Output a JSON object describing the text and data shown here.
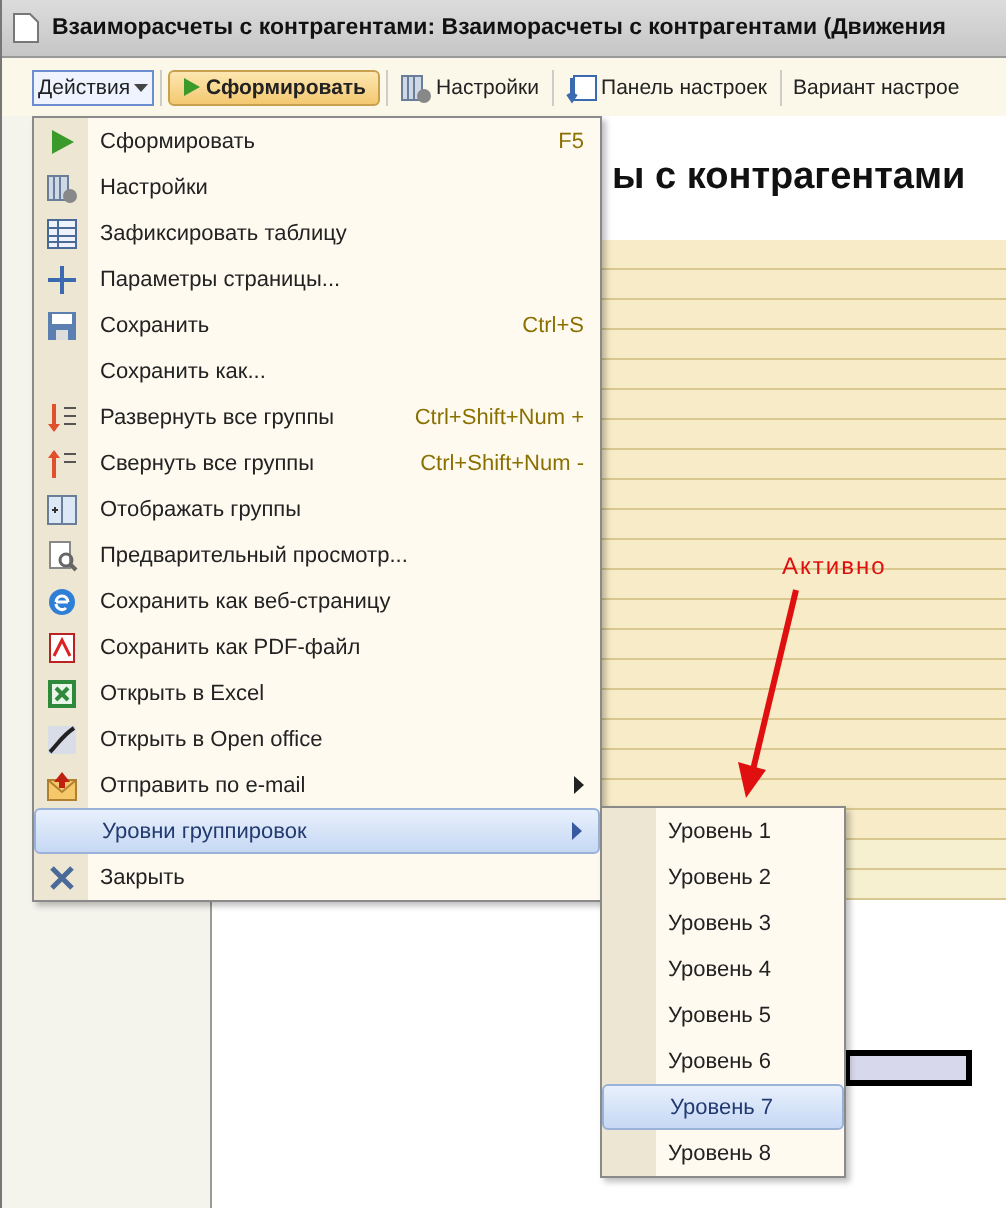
{
  "window": {
    "title": "Взаиморасчеты с контрагентами: Взаиморасчеты с контрагентами (Движения"
  },
  "toolbar": [
    {
      "kind": "menu",
      "label": "Действия",
      "open": true
    },
    {
      "kind": "primary",
      "label": "Сформировать"
    },
    {
      "kind": "plain",
      "label": "Настройки"
    },
    {
      "kind": "plain",
      "label": "Панель настроек"
    },
    {
      "kind": "plain",
      "label": "Вариант настрое"
    }
  ],
  "report": {
    "title_fragment": "ы с контрагентами"
  },
  "annotation": {
    "text": "Активно"
  },
  "actions_menu": [
    {
      "label": "Сформировать",
      "shortcut": "F5",
      "has_submenu": false,
      "selected": false
    },
    {
      "label": "Настройки",
      "has_submenu": false,
      "selected": false
    },
    {
      "label": "Зафиксировать таблицу",
      "has_submenu": false,
      "selected": false
    },
    {
      "label": "Параметры страницы...",
      "has_submenu": false,
      "selected": false
    },
    {
      "label": "Сохранить",
      "shortcut": "Ctrl+S",
      "has_submenu": false,
      "selected": false
    },
    {
      "label": "Сохранить как...",
      "has_submenu": false,
      "selected": false
    },
    {
      "label": "Развернуть все группы",
      "shortcut": "Ctrl+Shift+Num +",
      "has_submenu": false,
      "selected": false
    },
    {
      "label": "Свернуть все группы",
      "shortcut": "Ctrl+Shift+Num -",
      "has_submenu": false,
      "selected": false
    },
    {
      "label": "Отображать группы",
      "has_submenu": false,
      "selected": false
    },
    {
      "label": "Предварительный просмотр...",
      "has_submenu": false,
      "selected": false
    },
    {
      "label": "Сохранить как веб-страницу",
      "has_submenu": false,
      "selected": false
    },
    {
      "label": "Сохранить как PDF-файл",
      "has_submenu": false,
      "selected": false
    },
    {
      "label": "Открыть в Excel",
      "has_submenu": false,
      "selected": false
    },
    {
      "label": "Открыть в Open office",
      "has_submenu": false,
      "selected": false
    },
    {
      "label": "Отправить по e-mail",
      "has_submenu": true,
      "selected": false
    },
    {
      "label": "Уровни группировок",
      "has_submenu": true,
      "selected": true
    },
    {
      "label": "Закрыть",
      "has_submenu": false,
      "selected": false
    }
  ],
  "levels_submenu": [
    {
      "label": "Уровень 1",
      "selected": false
    },
    {
      "label": "Уровень 2",
      "selected": false
    },
    {
      "label": "Уровень 3",
      "selected": false
    },
    {
      "label": "Уровень 4",
      "selected": false
    },
    {
      "label": "Уровень 5",
      "selected": false
    },
    {
      "label": "Уровень 6",
      "selected": false
    },
    {
      "label": "Уровень 7",
      "selected": true
    },
    {
      "label": "Уровень 8",
      "selected": false
    }
  ]
}
